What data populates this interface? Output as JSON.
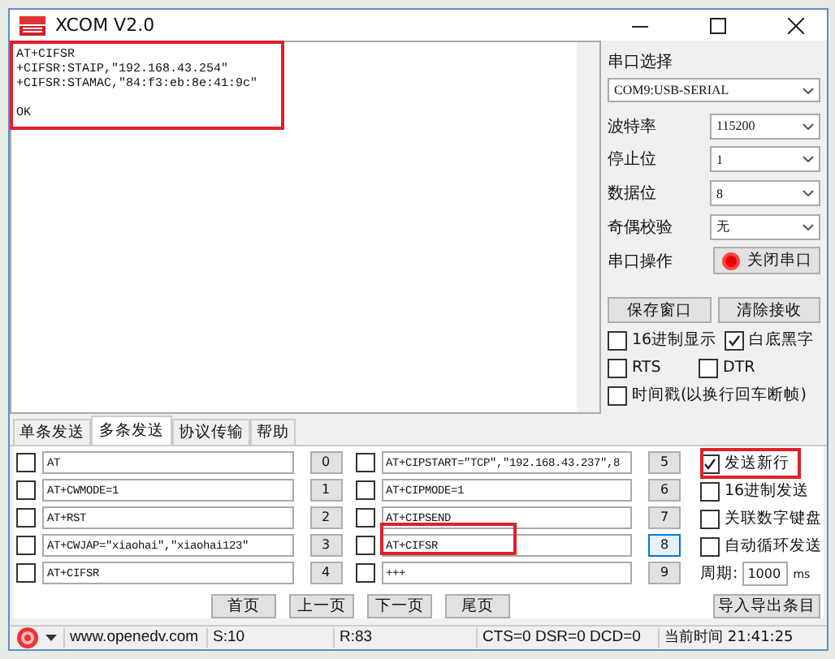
{
  "window": {
    "title": "XCOM V2.0"
  },
  "receive_text": "AT+CIFSR\n+CIFSR:STAIP,\"192.168.43.254\"\n+CIFSR:STAMAC,\"84:f3:eb:8e:41:9c\"\n\nOK",
  "port": {
    "label": "串口选择",
    "value": "COM9:USB-SERIAL"
  },
  "fields": [
    {
      "label": "波特率",
      "value": "115200"
    },
    {
      "label": "停止位",
      "value": "1"
    },
    {
      "label": "数据位",
      "value": "8"
    },
    {
      "label": "奇偶校验",
      "value": "无"
    }
  ],
  "serial_op": {
    "label": "串口操作",
    "button": "关闭串口",
    "open": true
  },
  "panel_buttons": [
    "保存窗口",
    "清除接收"
  ],
  "options": [
    {
      "label": "16进制显示",
      "checked": false
    },
    {
      "label": "白底黑字",
      "checked": true
    },
    {
      "label": "RTS",
      "checked": false
    },
    {
      "label": "DTR",
      "checked": false
    },
    {
      "label": "时间戳(以换行回车断帧)",
      "checked": false
    }
  ],
  "tabs": [
    {
      "label": "单条发送",
      "selected": false
    },
    {
      "label": "多条发送",
      "selected": true
    },
    {
      "label": "协议传输",
      "selected": false
    },
    {
      "label": "帮助",
      "selected": false
    }
  ],
  "entries": [
    {
      "checked": false,
      "text": "AT",
      "button": "0",
      "focused": false
    },
    {
      "checked": false,
      "text": "AT+CWMODE=1",
      "button": "1",
      "focused": false
    },
    {
      "checked": false,
      "text": "AT+RST",
      "button": "2",
      "focused": false
    },
    {
      "checked": false,
      "text": "AT+CWJAP=\"xiaohai\",\"xiaohai123\"",
      "button": "3",
      "focused": false
    },
    {
      "checked": false,
      "text": "AT+CIFSR",
      "button": "4",
      "focused": false
    },
    {
      "checked": false,
      "text": "AT+CIPSTART=\"TCP\",\"192.168.43.237\",8",
      "button": "5",
      "focused": false
    },
    {
      "checked": false,
      "text": "AT+CIPMODE=1",
      "button": "6",
      "focused": false
    },
    {
      "checked": false,
      "text": "AT+CIPSEND",
      "button": "7",
      "focused": false
    },
    {
      "checked": false,
      "text": "AT+CIFSR",
      "button": "8",
      "focused": true
    },
    {
      "checked": false,
      "text": "+++",
      "button": "9",
      "focused": false
    }
  ],
  "send_options": [
    {
      "label": "发送新行",
      "checked": true
    },
    {
      "label": "16进制发送",
      "checked": false
    },
    {
      "label": "关联数字键盘",
      "checked": false
    },
    {
      "label": "自动循环发送",
      "checked": false
    }
  ],
  "period": {
    "label": "周期:",
    "value": "1000",
    "unit": "ms"
  },
  "page_buttons": [
    "首页",
    "上一页",
    "下一页",
    "尾页"
  ],
  "import_button": "导入导出条目",
  "status_bar": {
    "website": "www.openedv.com",
    "sent": "S:10",
    "received": "R:83",
    "lines": "CTS=0 DSR=0 DCD=0",
    "time": "当前时间 21:41:25"
  }
}
